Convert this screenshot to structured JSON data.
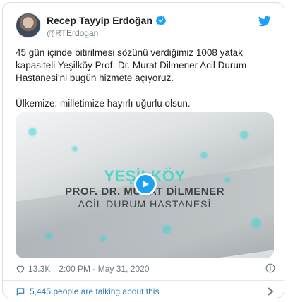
{
  "user": {
    "name": "Recep Tayyip Erdoğan",
    "handle": "@RTErdogan",
    "verified_icon": "verified-badge-icon",
    "brand_icon": "twitter-bird-icon"
  },
  "tweet": {
    "paragraph_1": "45 gün içinde bitirilmesi sözünü verdiğimiz 1008 yatak kapasiteli Yeşilköy Prof. Dr. Murat Dilmener Acil Durum Hastanesi'ni bugün hizmete açıyoruz.",
    "paragraph_2": "Ülkemize, milletimize hayırlı uğurlu olsun."
  },
  "video": {
    "title_line_1": "YEŞİLKÖY",
    "title_line_2": "PROF. DR. MURAT DİLMENER",
    "title_line_3": "ACİL DURUM HASTANESİ",
    "play_icon": "play-icon"
  },
  "meta": {
    "likes": "13.3K",
    "timestamp": "2:00 PM - May 31, 2020",
    "info_icon": "info-icon"
  },
  "footer": {
    "talking": "5,445 people are talking about this"
  },
  "colors": {
    "brand_blue": "#1da1f2",
    "link_blue": "#2b7bb9",
    "video_accent": "#4fd6c8",
    "muted_text": "#697882"
  }
}
